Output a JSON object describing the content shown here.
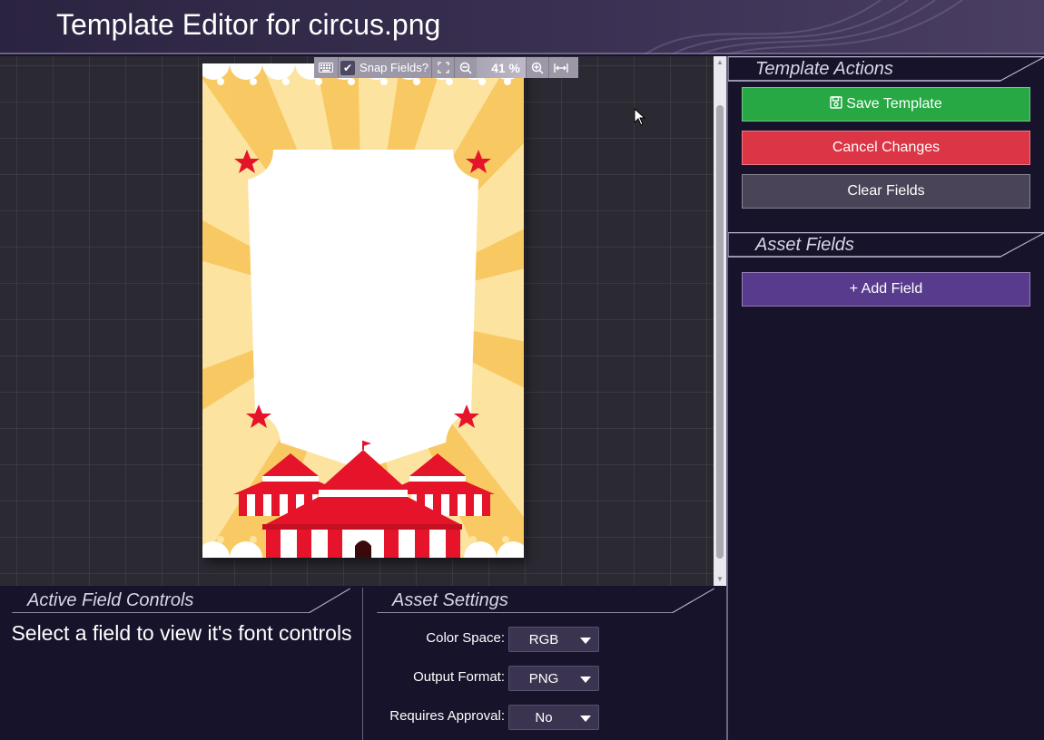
{
  "header": {
    "title": "Template Editor for circus.png"
  },
  "toolbar": {
    "keyboard_icon": "keyboard-icon",
    "snap_checked": true,
    "snap_label": "Snap Fields?",
    "zoom_value": "41 %"
  },
  "template_actions": {
    "heading": "Template Actions",
    "save_label": "Save Template",
    "cancel_label": "Cancel Changes",
    "clear_label": "Clear Fields"
  },
  "asset_fields": {
    "heading": "Asset Fields",
    "add_label": "+ Add Field"
  },
  "active_field_controls": {
    "heading": "Active Field Controls",
    "message": "Select a field to view it's font controls"
  },
  "asset_settings": {
    "heading": "Asset Settings",
    "rows": [
      {
        "label": "Color Space:",
        "value": "RGB"
      },
      {
        "label": "Output Format:",
        "value": "PNG"
      },
      {
        "label": "Requires Approval:",
        "value": "No"
      }
    ]
  },
  "colors": {
    "save": "#27a844",
    "cancel": "#dc3545",
    "clear": "#4a4458",
    "add": "#583b8c",
    "panel_bg": "#16132a",
    "canvas_bg": "#2b2a33"
  }
}
